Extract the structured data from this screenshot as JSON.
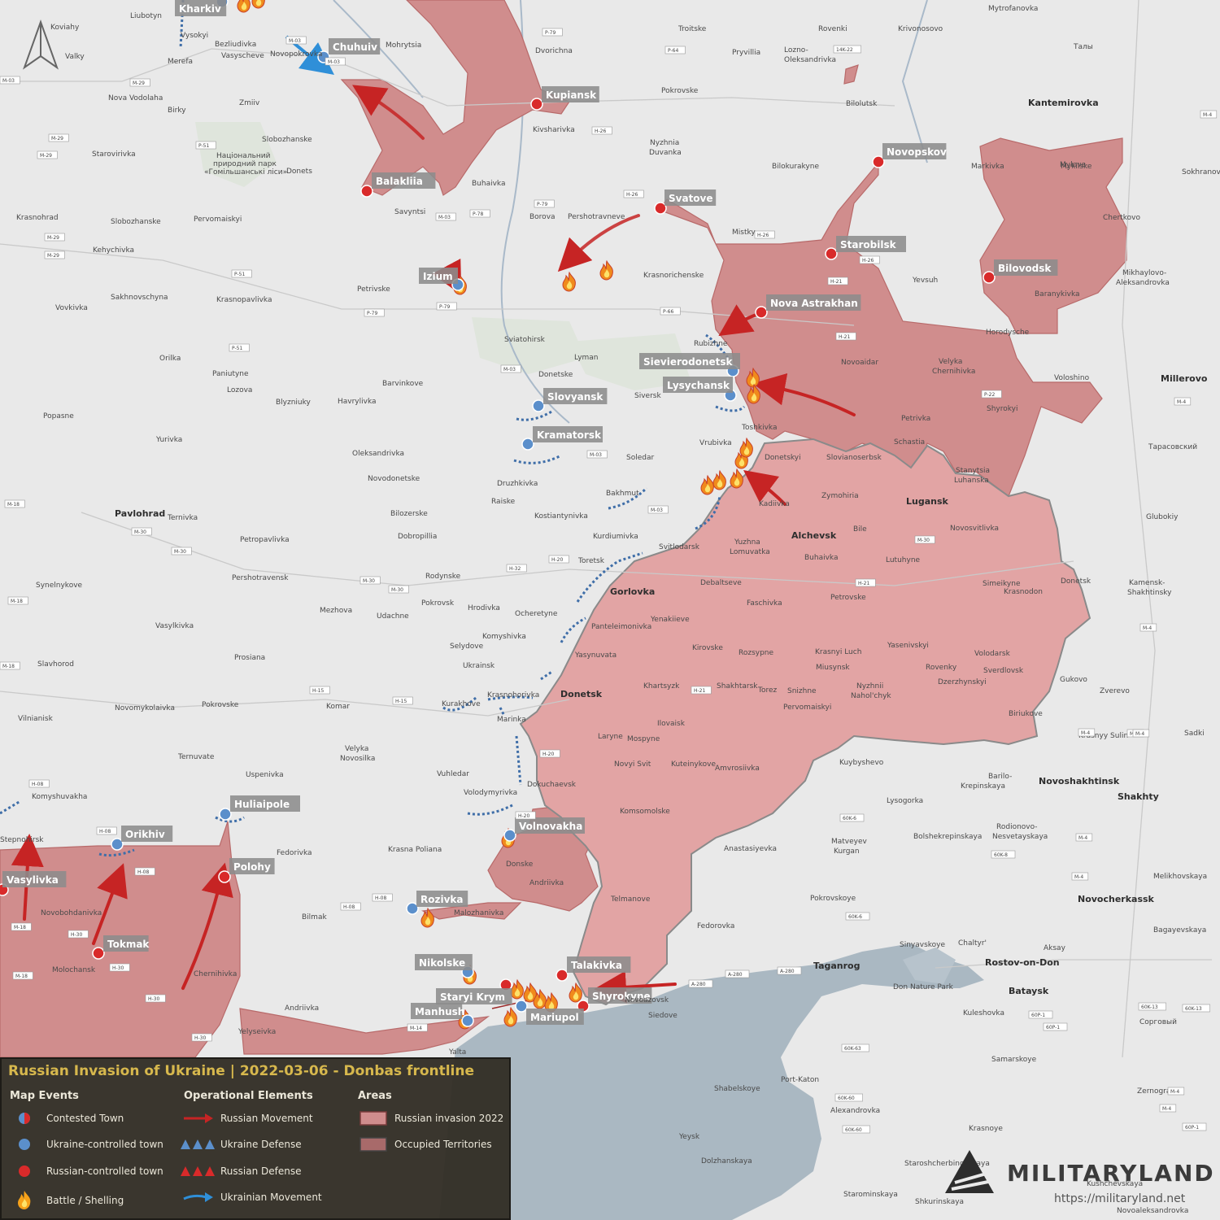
{
  "legend": {
    "title": "Russian Invasion of Ukraine | 2022-03-06 - Donbas frontline",
    "map_events_heading": "Map Events",
    "operational_heading": "Operational Elements",
    "areas_heading": "Areas",
    "contested_town": "Contested Town",
    "ukraine_town": "Ukraine-controlled town",
    "russian_town": "Russian-controlled town",
    "battle": "Battle / Shelling",
    "russian_movement": "Russian Movement",
    "ukraine_defense": "Ukraine Defense",
    "russian_defense": "Russian Defense",
    "ukrainian_movement": "Ukrainian Movement",
    "russian_invasion": "Russian invasion 2022",
    "occupied_territories": "Occupied Territories"
  },
  "branding": {
    "name": "MILITARYLAND",
    "url": "https://militaryland.net"
  },
  "colors": {
    "background": "#e9e9e9",
    "sea": "#aab8c2",
    "occupied": "#e2a4a4",
    "invasion": "#d08d8d",
    "russian_town": "#d92a2a",
    "ukraine_town": "#5b8fcb",
    "defense_ua": "#3f6ea8",
    "label_box": "#8c8c8c"
  },
  "tagged_towns": {
    "kharkiv": "Kharkiv",
    "chuhuiv": "Chuhuiv",
    "kupiansk": "Kupiansk",
    "balakliia": "Balakliia",
    "izium": "Izium",
    "svatove": "Svatove",
    "novopskov": "Novopskov",
    "starobilsk": "Starobilsk",
    "bilovodsk": "Bilovodsk",
    "nova_astrakhan": "Nova Astrakhan",
    "sievierodonetsk": "Sievierodonetsk",
    "lysychansk": "Lysychansk",
    "slovyansk": "Slovyansk",
    "kramatorsk": "Kramatorsk",
    "huliaipole": "Huliaipole",
    "orikhiv": "Orikhiv",
    "vasylivka": "Vasylivka",
    "polohy": "Polohy",
    "tokmak": "Tokmak",
    "volnovakha": "Volnovakha",
    "rozivka": "Rozivka",
    "nikolske": "Nikolske",
    "talakivka": "Talakivka",
    "staryi_krym": "Staryi Krym",
    "shyrokyne": "Shyrokyne",
    "manhush": "Manhush",
    "mariupol": "Mariupol"
  },
  "places": {
    "liubotyn": "Liubotyn",
    "koviahy": "Koviahy",
    "valky": "Valky",
    "merefa": "Merefa",
    "vysokyi": "Vysokyi",
    "bezliudivka": "Bezliudivka",
    "vasyscheve": "Vasyscheve",
    "novopokrovka": "Novopokrovka",
    "mohrytsia": "Mohrytsia",
    "nova_vodolaha": "Nova Vodolaha",
    "zmiiv": "Zmiiv",
    "birky": "Birky",
    "slobozhanske": "Slobozhanske",
    "starovirivka": "Starovirivka",
    "donets": "Donets",
    "park1": "Національний",
    "park2": "природний парк",
    "park3": "«Гомільшанські ліси»",
    "krasnohrad": "Krasnohrad",
    "slobozhanske2": "Slobozhanske",
    "pervomaiskyi": "Pervomaiskyi",
    "savyntsi": "Savyntsi",
    "kehychivka": "Kehychivka",
    "sakhnovschyna": "Sakhnovschyna",
    "krasnopavlivka": "Krasnopavlivka",
    "vovkivka": "Vovkivka",
    "petrivske": "Petrivske",
    "orilka": "Orilka",
    "lozova": "Lozova",
    "paniutyne": "Paniutyne",
    "blyzniuky": "Blyzniuky",
    "havrylivka": "Havrylivka",
    "barvinkove": "Barvinkove",
    "yurivka": "Yurivka",
    "popasne": "Popasne",
    "sviatohirsk": "Sviatohirsk",
    "lyman": "Lyman",
    "donetske": "Donetske",
    "siversk": "Siversk",
    "pavlohrad": "Pavlohrad",
    "ternivka": "Ternivka",
    "petropavlivka": "Petropavlivka",
    "pershotravensk": "Pershotravensk",
    "oleksandrivka": "Oleksandrivka",
    "novodonetske": "Novodonetske",
    "bilozerske": "Bilozerske",
    "dobropillia": "Dobropillia",
    "druzhkivka": "Druzhkivka",
    "raiske": "Raiske",
    "kostiantynivka": "Kostiantynivka",
    "kurdiumivka": "Kurdiumivka",
    "toretsk": "Toretsk",
    "bakhmut": "Bakhmut",
    "soledar": "Soledar",
    "vrubivka": "Vrubivka",
    "toshkivka": "Toshkivka",
    "rodynske": "Rodynske",
    "pokrovsk": "Pokrovsk",
    "hrodivka": "Hrodivka",
    "ocheretyne": "Ocheretyne",
    "mezhova": "Mezhova",
    "udachne": "Udachne",
    "komyshivka": "Komyshivka",
    "selydove": "Selydove",
    "ukrainsk": "Ukrainsk",
    "vasylkivka": "Vasylkivka",
    "prosiana": "Prosiana",
    "slavhorod": "Slavhorod",
    "synelnykove": "Synelnykove",
    "kurakhove": "Kurakhove",
    "krasnohorivka": "Krasnohorivka",
    "marinka": "Marinka",
    "pokrovske": "Pokrovske",
    "komar": "Komar",
    "novomykolaivka": "Novomykolaivka",
    "vilnianisk": "Vilnianisk",
    "velyka_novosilka1": "Velyka",
    "velyka_novosilka2": "Novosilka",
    "ternuvate": "Ternuvate",
    "uspenivka": "Uspenivka",
    "vuhledar": "Vuhledar",
    "komyshuvakha": "Komyshuvakha",
    "volodymyrivka": "Volodymyrivka",
    "dokuchaevsk": "Dokuchaevsk",
    "fedorivka": "Fedorivka",
    "krasna_poliana": "Krasna Poliana",
    "donske": "Donske",
    "andriivka": "Andriivka",
    "bilmak": "Bilmak",
    "malozhanivka": "Malozhanivka",
    "novobohdanivka": "Novobohdanivka",
    "molochansk": "Molochansk",
    "chernihivka": "Chernihivka",
    "andriivka2": "Andriivka",
    "yelyseivka": "Yelyseivka",
    "yalta": "Yalta",
    "stepnohirsk": "Stepnohirsk",
    "dvorichna": "Dvorichna",
    "kivsharivka": "Kivsharivka",
    "buhaivka": "Buhaivka",
    "borova": "Borova",
    "pershotravneve": "Pershotravneve",
    "troitske": "Troitske",
    "pryvillia": "Pryvillia",
    "lozno_oleksandrivka1": "Lozno-",
    "lozno_oleksandrivka2": "Oleksandrivka",
    "pokrovske2": "Pokrovske",
    "nyzhnia_duvanka1": "Nyzhnia",
    "nyzhnia_duvanka2": "Duvanka",
    "krasnorichenske": "Krasnorichenske",
    "rovenki": "Rovenki",
    "krivonosovo": "Krivonosovo",
    "bilolutsk": "Bilolutsk",
    "bilokurakyne": "Bilokurakyne",
    "mistky": "Mistky",
    "yevsuh": "Yevsuh",
    "markivka": "Markivka",
    "mylove": "Mylove",
    "kantemirovka": "Kantemirovka",
    "mytrofanovka": "Mytrofanovka",
    "taly": "Талы",
    "mykilske": "Mykilske",
    "chertkovo": "Chertkovo",
    "baranykivka": "Baranykivka",
    "mikhaylovo1": "Mikhaylovo-",
    "mikhaylovo2": "Aleksandrovka",
    "sokhranovka": "Sokhranovka",
    "rubizhne": "Rubizhne",
    "novoaidar": "Novoaidar",
    "velyka_chernihivka1": "Velyka",
    "velyka_chernihivka2": "Chernihivka",
    "voloshino": "Voloshino",
    "millerovo": "Millerovo",
    "petrivka": "Petrivka",
    "shyrokyi": "Shyrokyi",
    "horodysche": "Horodysche",
    "schastia": "Schastia",
    "stanytsia1": "Stanytsia",
    "stanytsia2": "Luhanska",
    "tarasovskiy": "Тарасовский",
    "donetskyi": "Donetskyi",
    "slovianoserbsk": "Slovianoserbsk",
    "zymohiria": "Zymohiria",
    "lugansk": "Lugansk",
    "kadiivka": "Kadiivka",
    "alchevsk": "Alchevsk",
    "bile": "Bile",
    "novosvitlivka": "Novosvitlivka",
    "yuzhna1": "Yuzhna",
    "yuzhna2": "Lomuvatka",
    "buhaivka2": "Buhaivka",
    "lutuhyne": "Lutuhyne",
    "svitlodarsk": "Svitlodarsk",
    "gorlovka": "Gorlovka",
    "debaltseve": "Debaltseve",
    "faschivka": "Faschivka",
    "petrovske": "Petrovske",
    "simeikyne": "Simeikyne",
    "krasnodon": "Krasnodon",
    "donetsk_ru": "Donetsk",
    "kamensk1": "Kamensk-",
    "kamensk2": "Shakhtinsky",
    "glubokiy": "Glubokiy",
    "panteleimonivka": "Panteleimonivka",
    "yenakiieve": "Yenakiieve",
    "yasynuvata": "Yasynuvata",
    "kirovske": "Kirovske",
    "rozsypne": "Rozsypne",
    "krasnyi_luch": "Krasnyi Luch",
    "yasenivskyi": "Yasenivskyi",
    "volodarsk": "Volodarsk",
    "miusynsk": "Miusynsk",
    "rovenky": "Rovenky",
    "sverdlovsk": "Sverdlovsk",
    "dzerzhynskyi": "Dzerzhynskyi",
    "gukovo": "Gukovo",
    "zverevo": "Zverevo",
    "donetsk": "Donetsk",
    "khartsyzk": "Khartsyzk",
    "shakhtarsk": "Shakhtarsk",
    "torez": "Torez",
    "snizhne": "Snizhne",
    "nyzhni_nahol1": "Nyzhnii",
    "nyzhni_nahol2": "Nahol'chyk",
    "pervomaiskyi2": "Pervomaiskyi",
    "biriukove": "Biriukove",
    "ilovaisk": "Ilovaisk",
    "laryne": "Laryne",
    "mospyne": "Mospyne",
    "krasnyy_sulin": "Krasnyy Sulin",
    "sadki": "Sadki",
    "novyi_svit": "Novyi Svit",
    "kuteinykove": "Kuteinykove",
    "amvrosiivka": "Amvrosiivka",
    "kuybyshevo": "Kuybyshevo",
    "barilo1": "Barilo-",
    "barilo2": "Krepinskaya",
    "novoshakhtinsk": "Novoshakhtinsk",
    "shakhty": "Shakhty",
    "lysogorka": "Lysogorka",
    "komsomolske": "Komsomolske",
    "bolshekrepinskaya": "Bolshekrepinskaya",
    "rodionovo1": "Rodionovo-",
    "rodionovo2": "Nesvetayskaya",
    "matveyev1": "Matveyev",
    "matveyev2": "Kurgan",
    "anastasiyevka": "Anastasiyevka",
    "melikhovskaya": "Melikhovskaya",
    "telmanove": "Telmanove",
    "pokrovskoye": "Pokrovskoye",
    "novocherkassk": "Novocherkassk",
    "fedorovka": "Fedorovka",
    "bagayevskaya": "Bagayevskaya",
    "sinyavskoye": "Sinyavskoye",
    "chaltyr": "Chaltyr'",
    "aksay": "Aksay",
    "rostov": "Rostov-on-Don",
    "taganrog": "Taganrog",
    "bataysk": "Bataysk",
    "don_nature": "Don Nature Park",
    "kuleshovka": "Kuleshovka",
    "sorgovyi": "Сорговый",
    "novoazovsk": "Novoazovsk",
    "siedove": "Siedove",
    "samarskoye": "Samarskoye",
    "zernograd": "Zernograd",
    "shabelskoye": "Shabelskoye",
    "port_katon": "Port-Katon",
    "alexandrovka": "Alexandrovka",
    "krasnoye": "Krasnoye",
    "yeysk": "Yeysk",
    "staroshcherbinovskaya": "Staroshcherbinovskaya",
    "dolzhanskaya": "Dolzhanskaya",
    "shkurinskaya": "Shkurinskaya",
    "kushchevskaya": "Kushchevskaya",
    "starominskaya": "Starominskaya",
    "novoaleksandrovka": "Novoaleksandrovka"
  },
  "roads": {
    "m03a": "M-03",
    "m03b": "M-03",
    "m29a": "M-29",
    "m29b": "M-29",
    "m29c": "M-29",
    "m29d": "M-29",
    "m29e": "M-29",
    "m03c": "M-03",
    "p51a": "P-51",
    "p51b": "P-51",
    "p51c": "P-51",
    "p79a": "P-79",
    "p79b": "P-79",
    "p79c": "P-79",
    "p79d": "P-79",
    "p78": "P-78",
    "h26a": "H-26",
    "h26b": "H-26",
    "h26c": "H-26",
    "h26d": "H-26",
    "p64": "P-64",
    "p66": "P-66",
    "k14_022": "14K-22",
    "h21a": "H-21",
    "h21b": "H-21",
    "h21c": "H-21",
    "m03d": "M-03",
    "m03e": "M-03",
    "m03f": "M-03",
    "m03g": "M-03",
    "p22": "P-22",
    "m04a": "M-4",
    "m04b": "M-4",
    "m04c": "M-4",
    "m04d": "M-4",
    "m18a": "M-18",
    "m18b": "M-18",
    "m18c": "M-18",
    "m30a": "M-30",
    "m30b": "M-30",
    "m30c": "M-30",
    "m30d": "M-30",
    "m30e": "M-30",
    "h20a": "H-20",
    "h20b": "H-20",
    "h20c": "H-20",
    "h32": "H-32",
    "h15a": "H-15",
    "h15b": "H-15",
    "h21d": "H-21",
    "h08a": "H-08",
    "h08b": "H-08",
    "h08c": "H-08",
    "h08d": "H-08",
    "h08e": "H-08",
    "h30a": "H-30",
    "h30b": "H-30",
    "h30c": "H-30",
    "h30d": "H-30",
    "m14": "M-14",
    "m18d": "M-18",
    "m18e": "M-18",
    "a280a": "A-280",
    "a280b": "A-280",
    "a280c": "A-280",
    "k60_6": "60K-6",
    "k60_8": "60K-8",
    "k60_13a": "60K-13",
    "k60_13b": "60K-13",
    "k60_63": "60K-63",
    "k60_60": "60K-60",
    "k60_60b": "60K-60",
    "p1a": "60P-1",
    "p1b": "60P-1",
    "p1c": "60P-1",
    "m4e": "M-4",
    "m4f": "M-4",
    "m4g": "M-4",
    "m4h": "M-4",
    "m4i": "M-4",
    "m4j": "M-4",
    "k60_6b": "60K-6"
  }
}
